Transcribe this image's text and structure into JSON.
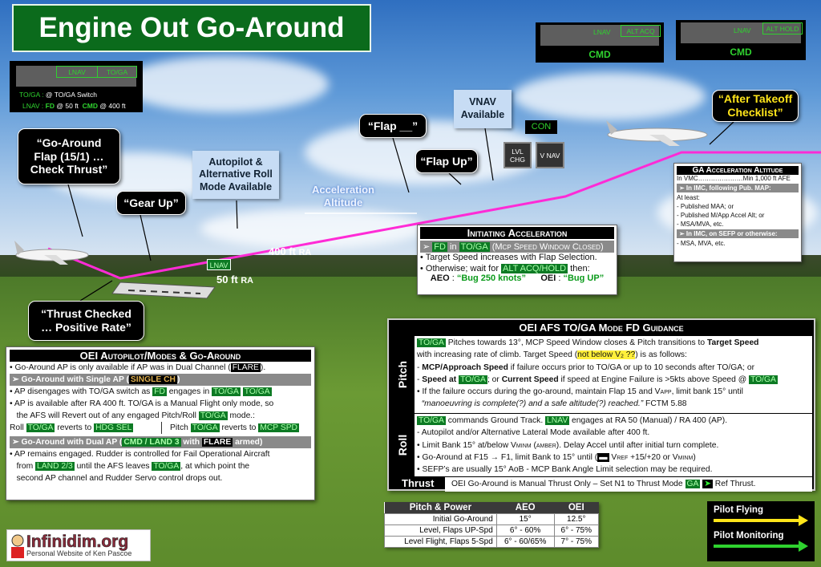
{
  "title": "Engine Out Go-Around",
  "colors": {
    "accent_green": "#0b6b1c",
    "flight_path": "#ff2bd6",
    "fma_green": "#2fd22f",
    "pilot_flying": "#ffe51a",
    "pilot_monitoring": "#2fd22f"
  },
  "fma_left": {
    "mode1": "LNAV",
    "mode2": "TO/GA",
    "row1_label": "TO/GA :",
    "row1_text": "@ TO/GA Switch",
    "row2_label": "LNAV :",
    "row2_fd": "FD",
    "row2_fd_text": "@ 50 ft",
    "row2_cmd": "CMD",
    "row2_cmd_text": "@ 400 ft"
  },
  "fma_acq": {
    "roll": "LNAV",
    "pitch": "ALT ACQ",
    "status": "CMD"
  },
  "fma_hold": {
    "roll": "LNAV",
    "pitch": "ALT HOLD",
    "status": "CMD"
  },
  "callouts": {
    "go_around": [
      "“Go-Around",
      "Flap (15/1) …",
      "Check Thrust”"
    ],
    "gear_up": "“Gear Up”",
    "thrust_checked": [
      "“Thrust Checked",
      "… Positive Rate”"
    ],
    "flap_blank": "“Flap __”",
    "flap_up": "“Flap Up”",
    "after_takeoff": [
      "“After Takeoff",
      "Checklist”"
    ]
  },
  "info": {
    "autopilot": [
      "Autopilot &",
      "Alternative Roll",
      "Mode Available"
    ],
    "vnav": [
      "VNAV",
      "Available"
    ]
  },
  "accel_alt": [
    "Acceleration",
    "Altitude"
  ],
  "alt_400": "400 ft",
  "alt_50": "50 ft",
  "ra": "RA",
  "lnav_badge": "LNAV",
  "mcp": {
    "con": "CON",
    "lvl_chg": "LVL CHG",
    "vnav": "V NAV"
  },
  "initiating": {
    "title": "Initiating Acceleration",
    "sub": [
      {
        "t": "➢  "
      },
      {
        "t": "FD",
        "c": "g"
      },
      {
        "t": " in "
      },
      {
        "t": "TO/GA",
        "c": "g"
      },
      {
        "t": " (Mcp Speed Window Closed)",
        "c": "sc"
      }
    ],
    "l1": [
      {
        "t": "• Target Speed increases with Flap Selection."
      }
    ],
    "l2": [
      {
        "t": "• Otherwise; wait for "
      },
      {
        "t": "ALT ACQ/HOLD",
        "c": "g"
      },
      {
        "t": " then:"
      }
    ],
    "l3": [
      {
        "t": "AEO",
        "c": "b"
      },
      {
        "t": " : "
      },
      {
        "t": "“Bug 250 knots”",
        "c": "gt"
      },
      {
        "t": "      "
      },
      {
        "t": "OEI",
        "c": "b"
      },
      {
        "t": " : "
      },
      {
        "t": "“Bug UP”",
        "c": "gt"
      }
    ]
  },
  "ga_accel": {
    "title": "GA Acceleration Altitude",
    "vmc": "In VMC…………………Min 1,000 ft AFE",
    "sub1": "➢     In IMC, following Pub. MAP:",
    "items1": [
      "At least:",
      "- Published MAA; or",
      "- Published M/App Accel Alt; or",
      "- MSA/MVA, etc."
    ],
    "sub2": "➢     In IMC, on SEFP or otherwise:",
    "items2": [
      "- MSA, MVA, etc."
    ]
  },
  "afs": {
    "title": "OEI AFS TO/GA Mode FD Guidance",
    "pitch_label": "Pitch",
    "roll_label": "Roll",
    "thrust_label": "Thrust",
    "pitch": [
      [
        {
          "t": "TO/GA",
          "c": "g"
        },
        {
          "t": " Pitches towards 13°, MCP Speed Window closes & Pitch transitions to "
        },
        {
          "t": "Target Speed",
          "c": "b"
        }
      ],
      [
        {
          "t": "with increasing rate of climb. Target Speed ("
        },
        {
          "t": "not below V₂ ??",
          "c": "yl"
        },
        {
          "t": ") is as follows:"
        }
      ],
      [
        {
          "t": "- "
        },
        {
          "t": "MCP/Approach Speed",
          "c": "b"
        },
        {
          "t": " if failure occurs prior to TO/GA or up to 10 seconds after TO/GA; or"
        }
      ],
      [
        {
          "t": "- "
        },
        {
          "t": "Speed at ",
          "c": "b"
        },
        {
          "t": "TO/GA",
          "c": "g"
        },
        {
          "t": "; or "
        },
        {
          "t": "Current Speed",
          "c": "b"
        },
        {
          "t": " if speed at Engine Failure is >5kts above Speed @ "
        },
        {
          "t": "TO/GA",
          "c": "g"
        }
      ],
      [
        {
          "t": "• If the failure occurs during the go-around, maintain Flap 15 and V"
        },
        {
          "t": "app",
          "c": "sc"
        },
        {
          "t": ", limit bank 15° until"
        }
      ],
      [
        {
          "t": "  “manoeuvring is complete(?) and a safe altitude(?) reached.”",
          "c": "i"
        },
        {
          "t": " FCTM 5.88"
        }
      ]
    ],
    "roll": [
      [
        {
          "t": "TO/GA",
          "c": "g"
        },
        {
          "t": " commands Ground Track. "
        },
        {
          "t": "LNAV",
          "c": "g"
        },
        {
          "t": " engages at RA 50 (Manual) / RA 400 (AP)."
        }
      ],
      [
        {
          "t": "- Autopilot and/or Alternative Lateral Mode available after 400 ft."
        }
      ],
      [
        {
          "t": "• Limit Bank 15° at/below V"
        },
        {
          "t": "minm (amber)",
          "c": "sc"
        },
        {
          "t": ". Delay Accel until after initial turn complete."
        }
      ],
      [
        {
          "t": "• Go-Around at F15 → F1, limit Bank to 15° until ("
        },
        {
          "t": "▬",
          "c": "k"
        },
        {
          "t": " V"
        },
        {
          "t": "ref",
          "c": "sc"
        },
        {
          "t": " +15/+20 or V"
        },
        {
          "t": "minm",
          "c": "sc"
        },
        {
          "t": ")"
        }
      ],
      [
        {
          "t": "• SEFP’s are usually 15° AoB - MCP Bank Angle Limit selection may be required."
        }
      ]
    ],
    "thrust": [
      {
        "t": "OEI Go-Around is Manual Thrust Only – Set N1 to Thrust Mode "
      },
      {
        "t": "GA",
        "c": "g"
      },
      {
        "t": " "
      },
      {
        "t": "➤",
        "c": "arr"
      },
      {
        "t": " Ref Thrust."
      }
    ]
  },
  "ap": {
    "title": "OEI Autopilot/Modes & Go-Around",
    "l1": [
      {
        "t": "• Go-Around AP is only available if AP was in Dual Channel ("
      },
      {
        "t": "FLARE",
        "c": "k"
      },
      {
        "t": ")."
      }
    ],
    "sub1": [
      {
        "t": "➢     Go-Around with Single AP ("
      },
      {
        "t": "SINGLE CH",
        "c": "a"
      },
      {
        "t": ")"
      }
    ],
    "l2": [
      {
        "t": "• AP disengages with TO/GA switch as "
      },
      {
        "t": "FD",
        "c": "g"
      },
      {
        "t": " engages in "
      },
      {
        "t": "TO/GA",
        "c": "g"
      },
      {
        "t": " "
      },
      {
        "t": "TO/GA",
        "c": "g"
      }
    ],
    "l3": [
      {
        "t": "• AP is available after RA 400 ft. TO/GA is a Manual Flight only mode, so"
      }
    ],
    "l4": [
      {
        "t": "   the AFS will Revert out of any engaged Pitch/Roll "
      },
      {
        "t": "TO/GA",
        "c": "g"
      },
      {
        "t": " mode.:"
      }
    ],
    "l5a": [
      {
        "t": "Roll "
      },
      {
        "t": "TO/GA",
        "c": "g"
      },
      {
        "t": " reverts to "
      },
      {
        "t": "HDG SEL",
        "c": "g"
      }
    ],
    "l5b": [
      {
        "t": "Pitch "
      },
      {
        "t": "TO/GA",
        "c": "g"
      },
      {
        "t": " reverts to "
      },
      {
        "t": "MCP SPD",
        "c": "g"
      }
    ],
    "sub2": [
      {
        "t": "➢     Go-Around with Dual AP ("
      },
      {
        "t": "CMD / LAND 3",
        "c": "g"
      },
      {
        "t": " with "
      },
      {
        "t": "FLARE",
        "c": "k"
      },
      {
        "t": " armed)"
      }
    ],
    "l6": [
      {
        "t": "• AP remains engaged. Rudder is controlled for Fail Operational Aircraft"
      }
    ],
    "l7": [
      {
        "t": "   from "
      },
      {
        "t": "LAND 2/3",
        "c": "g"
      },
      {
        "t": " until the AFS leaves "
      },
      {
        "t": "TO/GA",
        "c": "g"
      },
      {
        "t": ", at which point the"
      }
    ],
    "l8": [
      {
        "t": "   second AP channel and Rudder Servo control drops out."
      }
    ]
  },
  "pitch_table": {
    "headers": [
      "Pitch & Power",
      "AEO",
      "OEI"
    ],
    "rows": [
      [
        "Initial Go-Around",
        "15°",
        "12.5°"
      ],
      [
        "Level, Flaps UP-Spd",
        "6° - 60%",
        "6° - 75%"
      ],
      [
        "Level Flight, Flaps 5-Spd",
        "6° - 60/65%",
        "7° - 75%"
      ]
    ]
  },
  "legend": {
    "pf": "Pilot Flying",
    "pm": "Pilot Monitoring"
  },
  "logo": {
    "name": "Infinidim.org",
    "tagline": "Personal Website of Ken Pascoe"
  }
}
